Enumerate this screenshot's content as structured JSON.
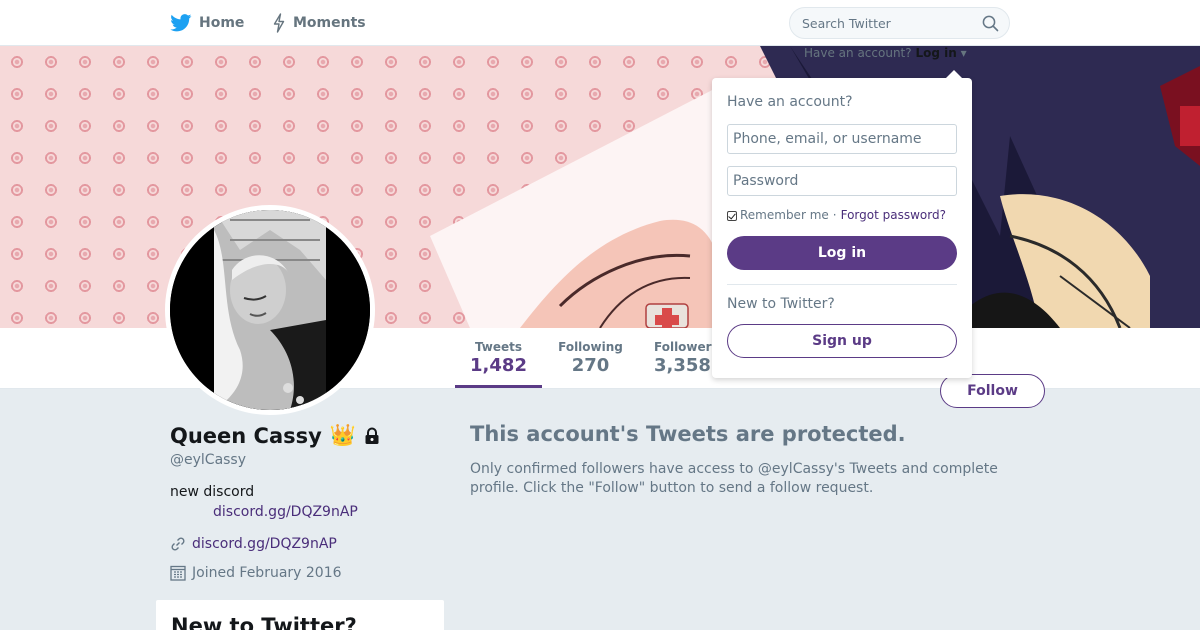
{
  "nav": {
    "home_label": "Home",
    "moments_label": "Moments"
  },
  "search": {
    "placeholder": "Search Twitter"
  },
  "login_hint": {
    "question": "Have an account?",
    "action": "Log in"
  },
  "stats": {
    "tweets_label": "Tweets",
    "tweets_value": "1,482",
    "following_label": "Following",
    "following_value": "270",
    "followers_label": "Followers",
    "followers_value": "3,358"
  },
  "follow_button": "Follow",
  "profile": {
    "name": "Queen Cassy",
    "name_emoji": "👑",
    "handle": "@eylCassy",
    "bio_line": "new discord",
    "bio_link": "discord.gg/DQZ9nAP",
    "url": "discord.gg/DQZ9nAP",
    "joined": "Joined February 2016"
  },
  "sidebar_signup": {
    "title": "New to Twitter?"
  },
  "protected": {
    "title": "This account's Tweets are protected.",
    "body": "Only confirmed followers have access to @eylCassy's Tweets and complete profile. Click the \"Follow\" button to send a follow request."
  },
  "login_dropdown": {
    "heading": "Have an account?",
    "username_placeholder": "Phone, email, or username",
    "password_placeholder": "Password",
    "remember_label": "Remember me",
    "separator": "·",
    "forgot_label": "Forgot password?",
    "login_button": "Log in",
    "new_label": "New to Twitter?",
    "signup_button": "Sign up"
  },
  "colors": {
    "accent": "#5b3b86",
    "link": "#4a2e7a",
    "muted": "#657786",
    "background": "#e6ecf0",
    "twitter_blue": "#1da1f2"
  },
  "icons": {
    "home": "twitter-bird-icon",
    "moments": "lightning-icon",
    "search": "search-icon",
    "lock": "lock-icon",
    "link": "link-icon",
    "calendar": "calendar-icon"
  }
}
